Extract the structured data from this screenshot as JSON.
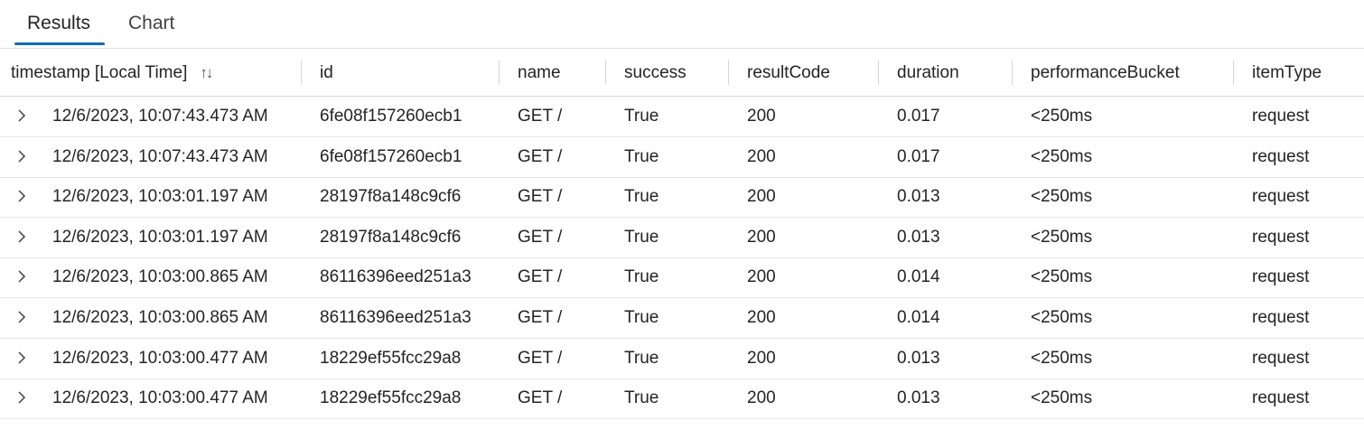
{
  "tabs": [
    {
      "label": "Results",
      "active": true
    },
    {
      "label": "Chart",
      "active": false
    }
  ],
  "columns": [
    {
      "key": "timestamp",
      "label": "timestamp [Local Time]"
    },
    {
      "key": "id",
      "label": "id"
    },
    {
      "key": "name",
      "label": "name"
    },
    {
      "key": "success",
      "label": "success"
    },
    {
      "key": "resultCode",
      "label": "resultCode"
    },
    {
      "key": "duration",
      "label": "duration"
    },
    {
      "key": "performanceBucket",
      "label": "performanceBucket"
    },
    {
      "key": "itemType",
      "label": "itemType"
    }
  ],
  "sort_icon": "sort-up-down-icon",
  "expand_icon": "chevron-right-icon",
  "accent_color": "#0f6cbd",
  "rows": [
    {
      "timestamp": "12/6/2023, 10:07:43.473 AM",
      "id": "6fe08f157260ecb1",
      "name": "GET /",
      "success": "True",
      "resultCode": "200",
      "duration": "0.017",
      "performanceBucket": "<250ms",
      "itemType": "request"
    },
    {
      "timestamp": "12/6/2023, 10:07:43.473 AM",
      "id": "6fe08f157260ecb1",
      "name": "GET /",
      "success": "True",
      "resultCode": "200",
      "duration": "0.017",
      "performanceBucket": "<250ms",
      "itemType": "request"
    },
    {
      "timestamp": "12/6/2023, 10:03:01.197 AM",
      "id": "28197f8a148c9cf6",
      "name": "GET /",
      "success": "True",
      "resultCode": "200",
      "duration": "0.013",
      "performanceBucket": "<250ms",
      "itemType": "request"
    },
    {
      "timestamp": "12/6/2023, 10:03:01.197 AM",
      "id": "28197f8a148c9cf6",
      "name": "GET /",
      "success": "True",
      "resultCode": "200",
      "duration": "0.013",
      "performanceBucket": "<250ms",
      "itemType": "request"
    },
    {
      "timestamp": "12/6/2023, 10:03:00.865 AM",
      "id": "86116396eed251a3",
      "name": "GET /",
      "success": "True",
      "resultCode": "200",
      "duration": "0.014",
      "performanceBucket": "<250ms",
      "itemType": "request"
    },
    {
      "timestamp": "12/6/2023, 10:03:00.865 AM",
      "id": "86116396eed251a3",
      "name": "GET /",
      "success": "True",
      "resultCode": "200",
      "duration": "0.014",
      "performanceBucket": "<250ms",
      "itemType": "request"
    },
    {
      "timestamp": "12/6/2023, 10:03:00.477 AM",
      "id": "18229ef55fcc29a8",
      "name": "GET /",
      "success": "True",
      "resultCode": "200",
      "duration": "0.013",
      "performanceBucket": "<250ms",
      "itemType": "request"
    },
    {
      "timestamp": "12/6/2023, 10:03:00.477 AM",
      "id": "18229ef55fcc29a8",
      "name": "GET /",
      "success": "True",
      "resultCode": "200",
      "duration": "0.013",
      "performanceBucket": "<250ms",
      "itemType": "request"
    }
  ]
}
